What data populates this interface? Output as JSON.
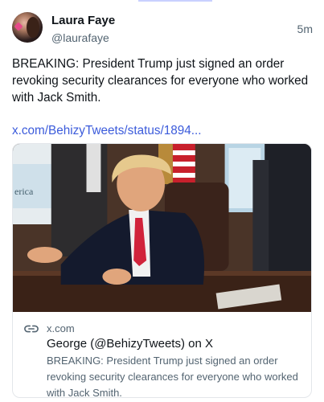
{
  "post": {
    "display_name": "Laura Faye",
    "handle": "@laurafaye",
    "time": "5m",
    "text": "BREAKING: President Trump just signed an order revoking security clearances for everyone who worked with Jack Smith.",
    "link_text": "x.com/BehizyTweets/status/1894..."
  },
  "card": {
    "domain": "x.com",
    "title": "George (@BehizyTweets) on X",
    "description": "BREAKING: President Trump just signed an order revoking security clearances for everyone who worked with Jack Smith.",
    "image_caption_fragment": "erica"
  },
  "colors": {
    "link": "#3b5bdb",
    "secondary_text": "#536471",
    "accent_bar": "#c9d0ff"
  },
  "icons": {
    "card_link": "link-icon"
  }
}
